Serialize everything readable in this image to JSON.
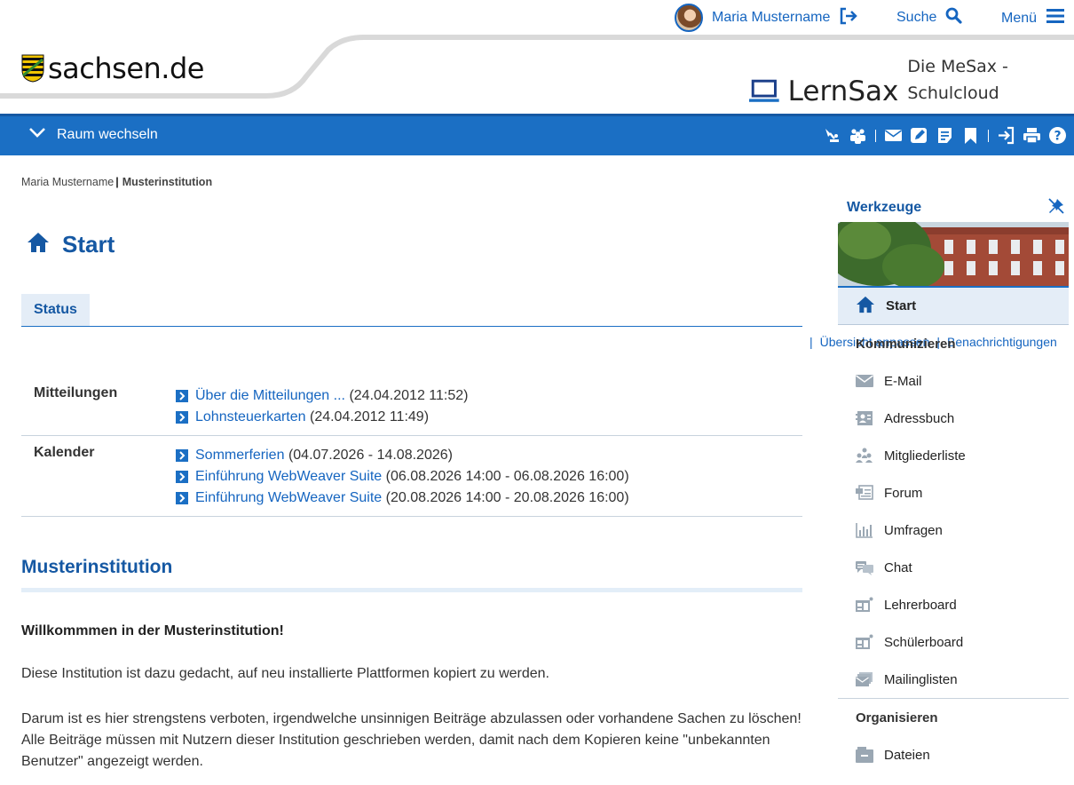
{
  "header": {
    "user_name": "Maria Mustername",
    "search_label": "Suche",
    "menu_label": "Menü",
    "sachsen_logo_text": "sachsen.de",
    "lernsax_title": "LernSax",
    "lernsax_subtitle": "Die MeSax - Schulcloud"
  },
  "toolbar": {
    "switch_room_label": "Raum wechseln",
    "icons": [
      "lamp-icon",
      "users-icon",
      "mail-icon",
      "edit-icon",
      "notes-icon",
      "bookmark-icon",
      "login-icon",
      "print-icon",
      "help-icon"
    ]
  },
  "breadcrumb": {
    "user": "Maria Mustername",
    "current": "Musterinstitution"
  },
  "main": {
    "title": "Start",
    "tab_label": "Status",
    "actions": {
      "customize": "Übersicht anpassen",
      "notifications": "Benachrichtigungen"
    },
    "status": {
      "messages_label": "Mitteilungen",
      "messages": [
        {
          "link": "Über die Mitteilungen ...",
          "date": "(24.04.2012 11:52)"
        },
        {
          "link": "Lohnsteuerkarten",
          "date": "(24.04.2012 11:49)"
        }
      ],
      "calendar_label": "Kalender",
      "calendar": [
        {
          "link": "Sommerferien",
          "date": "(04.07.2026 - 14.08.2026)"
        },
        {
          "link": "Einführung WebWeaver Suite",
          "date": "(06.08.2026 14:00 - 06.08.2026 16:00)"
        },
        {
          "link": "Einführung WebWeaver Suite",
          "date": "(20.08.2026 14:00 - 20.08.2026 16:00)"
        }
      ]
    },
    "section_title": "Musterinstitution",
    "welcome": "Willkommmen in der Musterinstitution!",
    "para1": "Diese Institution ist dazu gedacht, auf neu installierte Plattformen kopiert zu werden.",
    "para2": "Darum ist es hier strengstens verboten, irgendwelche unsinnigen Beiträge abzulassen oder vorhandene Sachen zu löschen! Alle Beiträge müssen mit Nutzern dieser Institution geschrieben werden, damit nach dem Kopieren keine \"unbekannten Benutzer\" angezeigt werden."
  },
  "sidebar": {
    "title": "Werkzeuge",
    "start_label": "Start",
    "group_communicate": "Kommunizieren",
    "communicate_items": [
      "E-Mail",
      "Adressbuch",
      "Mitgliederliste",
      "Forum",
      "Umfragen",
      "Chat",
      "Lehrerboard",
      "Schülerboard",
      "Mailinglisten"
    ],
    "group_organize": "Organisieren",
    "organize_items": [
      "Dateien"
    ]
  },
  "colors": {
    "brand_blue": "#1b6fc4",
    "title_blue": "#1558a3",
    "link_blue": "#1565c0",
    "tab_bg": "#e4edf7"
  }
}
